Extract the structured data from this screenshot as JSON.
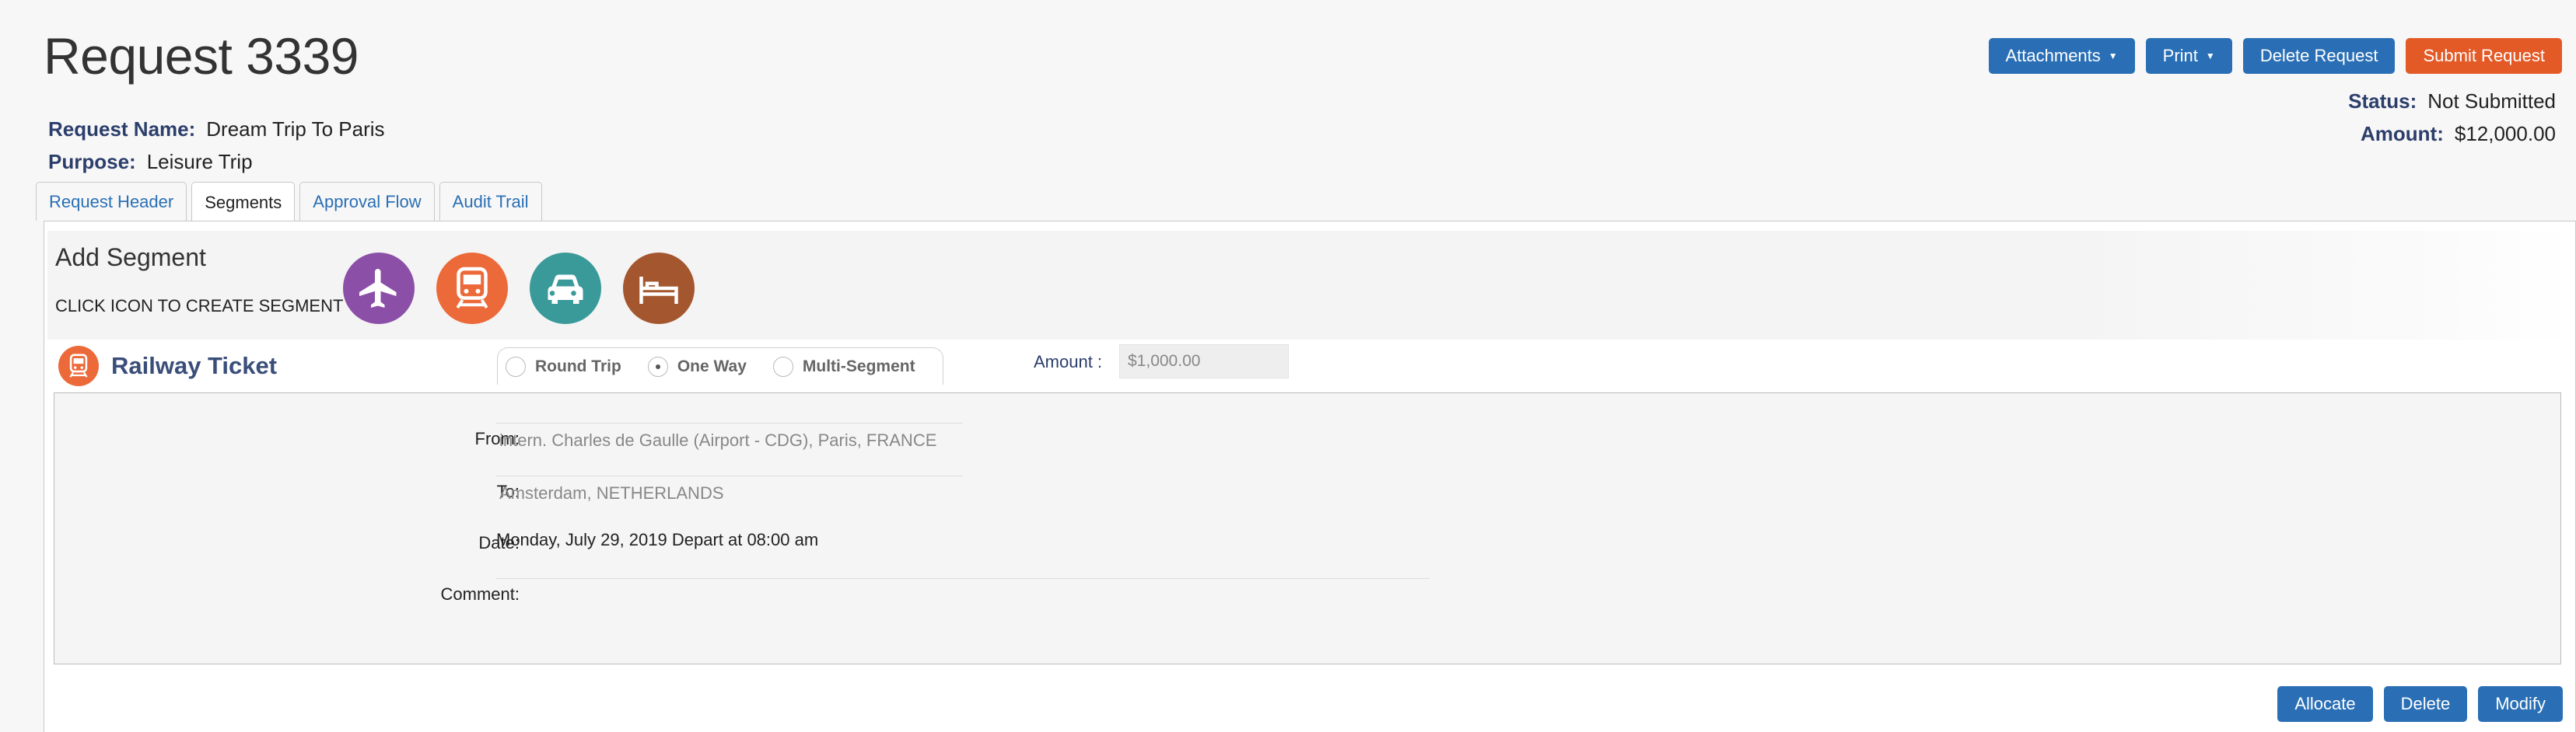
{
  "page": {
    "title": "Request 3339"
  },
  "toolbar": {
    "attachments": "Attachments",
    "print": "Print",
    "delete_request": "Delete Request",
    "submit_request": "Submit Request",
    "caret": "▼"
  },
  "request": {
    "name_label": "Request Name:",
    "name_value": "Dream Trip To Paris",
    "purpose_label": "Purpose:",
    "purpose_value": "Leisure Trip",
    "status_label": "Status:",
    "status_value": "Not Submitted",
    "amount_label": "Amount:",
    "amount_value": "$12,000.00"
  },
  "tabs": [
    {
      "label": "Request Header"
    },
    {
      "label": "Segments",
      "active": true
    },
    {
      "label": "Approval Flow"
    },
    {
      "label": "Audit Trail"
    }
  ],
  "add_segment": {
    "title": "Add Segment",
    "hint": "CLICK ICON TO CREATE SEGMENT",
    "icons": [
      {
        "name": "airplane-icon",
        "color": "#8b4fa8"
      },
      {
        "name": "train-icon",
        "color": "#ec6a3a"
      },
      {
        "name": "car-icon",
        "color": "#3a9a9a"
      },
      {
        "name": "hotel-bed-icon",
        "color": "#a4572e"
      }
    ]
  },
  "segment": {
    "title": "Railway Ticket",
    "trip_options": [
      "Round Trip",
      "One Way",
      "Multi-Segment"
    ],
    "selected_option": "One Way",
    "amount_label": "Amount :",
    "amount_value": "$1,000.00",
    "from_label": "From:",
    "from_value": "intern. Charles de Gaulle (Airport - CDG), Paris, FRANCE",
    "to_label": "To:",
    "to_value": "Amsterdam, NETHERLANDS",
    "date_label": "Date:",
    "date_value": "Monday, July 29, 2019 Depart at 08:00 am",
    "comment_label": "Comment:",
    "comment_value": ""
  },
  "segment_actions": {
    "allocate": "Allocate",
    "delete": "Delete",
    "modify": "Modify"
  }
}
